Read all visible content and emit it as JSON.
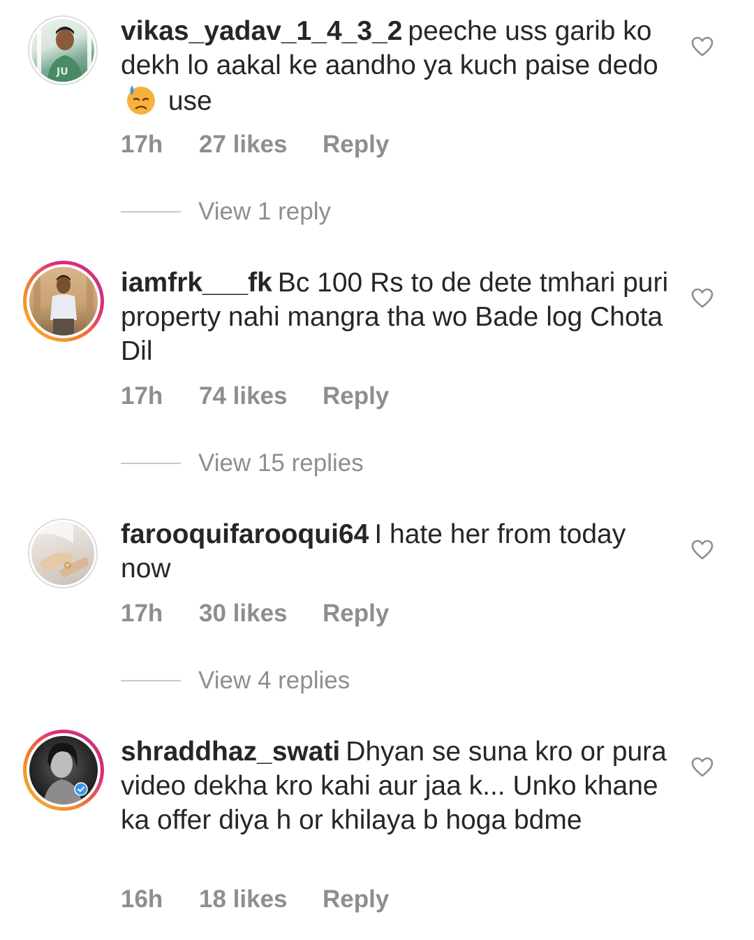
{
  "comments": [
    {
      "username": "vikas_yadav_1_4_3_2",
      "text_before_emoji": "peeche uss garib ko dekh lo aakal ke aandho ya kuch paise dedo",
      "emoji": "downcast-sweat-face",
      "text_after_emoji": "use",
      "time": "17h",
      "likes": "27 likes",
      "reply": "Reply",
      "view_replies": "View 1 reply",
      "avatar_ring": "none"
    },
    {
      "username": "iamfrk___fk",
      "text": "Bc 100 Rs to de dete tmhari puri property nahi mangra tha wo Bade log Chota Dil",
      "time": "17h",
      "likes": "74 likes",
      "reply": "Reply",
      "view_replies": "View 15 replies",
      "avatar_ring": "story-gradient"
    },
    {
      "username": "farooquifarooqui64",
      "text": "I hate her from today now",
      "time": "17h",
      "likes": "30 likes",
      "reply": "Reply",
      "view_replies": "View 4 replies",
      "avatar_ring": "none"
    },
    {
      "username": "shraddhaz_swati",
      "text": "Dhyan se suna kro or pura video dekha kro kahi aur jaa k... Unko khane ka offer diya h or khilaya b hoga bdme",
      "time": "16h",
      "likes": "18 likes",
      "reply": "Reply",
      "avatar_ring": "story-gradient",
      "verified_badge": "verified-icon"
    }
  ],
  "icons": {
    "like": "heart-outline-icon"
  },
  "colors": {
    "primary_text": "#262626",
    "secondary_text": "#8e8e8e",
    "divider": "#c7c7c7",
    "story_ring_start": "#f7b733",
    "story_ring_end": "#c13584",
    "verified": "#3897f0"
  }
}
